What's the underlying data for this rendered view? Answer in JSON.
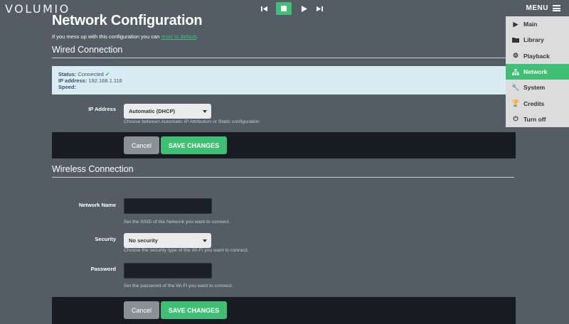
{
  "header": {
    "logo": "VOLUMIO",
    "menu_label": "MENU",
    "icons": [
      "skip-back-icon",
      "stop-icon",
      "play-icon",
      "skip-forward-icon",
      "menu-bars-icon"
    ]
  },
  "page": {
    "title": "Network Configuration",
    "subtitle_prefix": "If you mess up with this configuration you can ",
    "subtitle_link": "reset to default",
    "subtitle_suffix": "."
  },
  "wired": {
    "section_title": "Wired Connection",
    "status_label": "Status:",
    "status_value": "Connected",
    "ip_label": "IP address:",
    "ip_value": "192.168.1.116",
    "speed_label": "Speed:",
    "speed_value": "",
    "ip_address_label": "IP Address",
    "ip_address_select": "Automatic (DHCP)",
    "ip_address_help": "Choose between Automatic IP Attribution or Static configuration",
    "cancel_label": "Cancel",
    "save_label": "SAVE CHANGES"
  },
  "wireless": {
    "section_title": "Wireless Connection",
    "network_name_label": "Network Name",
    "network_name_value": "",
    "network_name_help": "Set the SSID of the Network you want to connect.",
    "security_label": "Security",
    "security_select": "No security",
    "security_help": "Choose the security type of the Wi-Fi you want to connect.",
    "password_label": "Password",
    "password_value": "",
    "password_help": "Set the password of the Wi-Fi you want to connect.",
    "cancel_label": "Cancel",
    "save_label": "SAVE CHANGES"
  },
  "menu": {
    "items": [
      {
        "label": "Main",
        "icon": "play-icon",
        "active": false
      },
      {
        "label": "Library",
        "icon": "folder-icon",
        "active": false
      },
      {
        "label": "Playback",
        "icon": "gears-icon",
        "active": false
      },
      {
        "label": "Network",
        "icon": "network-icon",
        "active": true
      },
      {
        "label": "System",
        "icon": "wrench-icon",
        "active": false
      },
      {
        "label": "Credits",
        "icon": "trophy-icon",
        "active": false
      },
      {
        "label": "Turn off",
        "icon": "power-icon",
        "active": false
      }
    ]
  },
  "colors": {
    "accent": "#3fbf73",
    "background": "#545c66",
    "status_box": "#d9ecf4",
    "action_bar": "#181c22",
    "menu_bg": "#dcdcdc"
  }
}
